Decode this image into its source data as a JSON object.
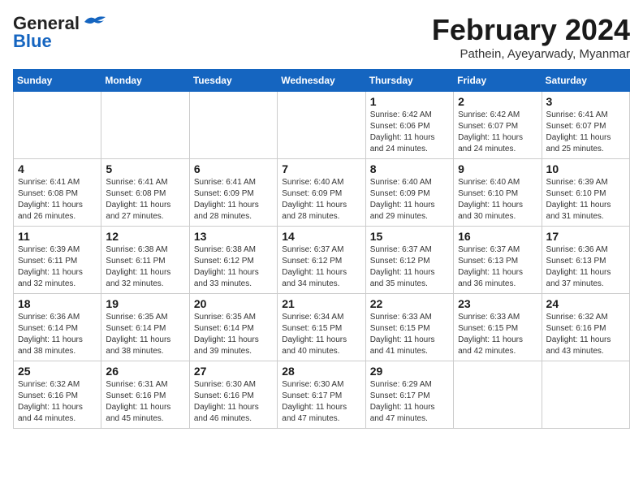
{
  "header": {
    "logo_general": "General",
    "logo_blue": "Blue",
    "month_title": "February 2024",
    "subtitle": "Pathein, Ayeyarwady, Myanmar"
  },
  "calendar": {
    "days_of_week": [
      "Sunday",
      "Monday",
      "Tuesday",
      "Wednesday",
      "Thursday",
      "Friday",
      "Saturday"
    ],
    "weeks": [
      [
        {
          "day": "",
          "sunrise": "",
          "sunset": "",
          "daylight": "",
          "empty": true
        },
        {
          "day": "",
          "sunrise": "",
          "sunset": "",
          "daylight": "",
          "empty": true
        },
        {
          "day": "",
          "sunrise": "",
          "sunset": "",
          "daylight": "",
          "empty": true
        },
        {
          "day": "",
          "sunrise": "",
          "sunset": "",
          "daylight": "",
          "empty": true
        },
        {
          "day": "1",
          "sunrise": "Sunrise: 6:42 AM",
          "sunset": "Sunset: 6:06 PM",
          "daylight": "Daylight: 11 hours and 24 minutes.",
          "empty": false
        },
        {
          "day": "2",
          "sunrise": "Sunrise: 6:42 AM",
          "sunset": "Sunset: 6:07 PM",
          "daylight": "Daylight: 11 hours and 24 minutes.",
          "empty": false
        },
        {
          "day": "3",
          "sunrise": "Sunrise: 6:41 AM",
          "sunset": "Sunset: 6:07 PM",
          "daylight": "Daylight: 11 hours and 25 minutes.",
          "empty": false
        }
      ],
      [
        {
          "day": "4",
          "sunrise": "Sunrise: 6:41 AM",
          "sunset": "Sunset: 6:08 PM",
          "daylight": "Daylight: 11 hours and 26 minutes.",
          "empty": false
        },
        {
          "day": "5",
          "sunrise": "Sunrise: 6:41 AM",
          "sunset": "Sunset: 6:08 PM",
          "daylight": "Daylight: 11 hours and 27 minutes.",
          "empty": false
        },
        {
          "day": "6",
          "sunrise": "Sunrise: 6:41 AM",
          "sunset": "Sunset: 6:09 PM",
          "daylight": "Daylight: 11 hours and 28 minutes.",
          "empty": false
        },
        {
          "day": "7",
          "sunrise": "Sunrise: 6:40 AM",
          "sunset": "Sunset: 6:09 PM",
          "daylight": "Daylight: 11 hours and 28 minutes.",
          "empty": false
        },
        {
          "day": "8",
          "sunrise": "Sunrise: 6:40 AM",
          "sunset": "Sunset: 6:09 PM",
          "daylight": "Daylight: 11 hours and 29 minutes.",
          "empty": false
        },
        {
          "day": "9",
          "sunrise": "Sunrise: 6:40 AM",
          "sunset": "Sunset: 6:10 PM",
          "daylight": "Daylight: 11 hours and 30 minutes.",
          "empty": false
        },
        {
          "day": "10",
          "sunrise": "Sunrise: 6:39 AM",
          "sunset": "Sunset: 6:10 PM",
          "daylight": "Daylight: 11 hours and 31 minutes.",
          "empty": false
        }
      ],
      [
        {
          "day": "11",
          "sunrise": "Sunrise: 6:39 AM",
          "sunset": "Sunset: 6:11 PM",
          "daylight": "Daylight: 11 hours and 32 minutes.",
          "empty": false
        },
        {
          "day": "12",
          "sunrise": "Sunrise: 6:38 AM",
          "sunset": "Sunset: 6:11 PM",
          "daylight": "Daylight: 11 hours and 32 minutes.",
          "empty": false
        },
        {
          "day": "13",
          "sunrise": "Sunrise: 6:38 AM",
          "sunset": "Sunset: 6:12 PM",
          "daylight": "Daylight: 11 hours and 33 minutes.",
          "empty": false
        },
        {
          "day": "14",
          "sunrise": "Sunrise: 6:37 AM",
          "sunset": "Sunset: 6:12 PM",
          "daylight": "Daylight: 11 hours and 34 minutes.",
          "empty": false
        },
        {
          "day": "15",
          "sunrise": "Sunrise: 6:37 AM",
          "sunset": "Sunset: 6:12 PM",
          "daylight": "Daylight: 11 hours and 35 minutes.",
          "empty": false
        },
        {
          "day": "16",
          "sunrise": "Sunrise: 6:37 AM",
          "sunset": "Sunset: 6:13 PM",
          "daylight": "Daylight: 11 hours and 36 minutes.",
          "empty": false
        },
        {
          "day": "17",
          "sunrise": "Sunrise: 6:36 AM",
          "sunset": "Sunset: 6:13 PM",
          "daylight": "Daylight: 11 hours and 37 minutes.",
          "empty": false
        }
      ],
      [
        {
          "day": "18",
          "sunrise": "Sunrise: 6:36 AM",
          "sunset": "Sunset: 6:14 PM",
          "daylight": "Daylight: 11 hours and 38 minutes.",
          "empty": false
        },
        {
          "day": "19",
          "sunrise": "Sunrise: 6:35 AM",
          "sunset": "Sunset: 6:14 PM",
          "daylight": "Daylight: 11 hours and 38 minutes.",
          "empty": false
        },
        {
          "day": "20",
          "sunrise": "Sunrise: 6:35 AM",
          "sunset": "Sunset: 6:14 PM",
          "daylight": "Daylight: 11 hours and 39 minutes.",
          "empty": false
        },
        {
          "day": "21",
          "sunrise": "Sunrise: 6:34 AM",
          "sunset": "Sunset: 6:15 PM",
          "daylight": "Daylight: 11 hours and 40 minutes.",
          "empty": false
        },
        {
          "day": "22",
          "sunrise": "Sunrise: 6:33 AM",
          "sunset": "Sunset: 6:15 PM",
          "daylight": "Daylight: 11 hours and 41 minutes.",
          "empty": false
        },
        {
          "day": "23",
          "sunrise": "Sunrise: 6:33 AM",
          "sunset": "Sunset: 6:15 PM",
          "daylight": "Daylight: 11 hours and 42 minutes.",
          "empty": false
        },
        {
          "day": "24",
          "sunrise": "Sunrise: 6:32 AM",
          "sunset": "Sunset: 6:16 PM",
          "daylight": "Daylight: 11 hours and 43 minutes.",
          "empty": false
        }
      ],
      [
        {
          "day": "25",
          "sunrise": "Sunrise: 6:32 AM",
          "sunset": "Sunset: 6:16 PM",
          "daylight": "Daylight: 11 hours and 44 minutes.",
          "empty": false
        },
        {
          "day": "26",
          "sunrise": "Sunrise: 6:31 AM",
          "sunset": "Sunset: 6:16 PM",
          "daylight": "Daylight: 11 hours and 45 minutes.",
          "empty": false
        },
        {
          "day": "27",
          "sunrise": "Sunrise: 6:30 AM",
          "sunset": "Sunset: 6:16 PM",
          "daylight": "Daylight: 11 hours and 46 minutes.",
          "empty": false
        },
        {
          "day": "28",
          "sunrise": "Sunrise: 6:30 AM",
          "sunset": "Sunset: 6:17 PM",
          "daylight": "Daylight: 11 hours and 47 minutes.",
          "empty": false
        },
        {
          "day": "29",
          "sunrise": "Sunrise: 6:29 AM",
          "sunset": "Sunset: 6:17 PM",
          "daylight": "Daylight: 11 hours and 47 minutes.",
          "empty": false
        },
        {
          "day": "",
          "sunrise": "",
          "sunset": "",
          "daylight": "",
          "empty": true
        },
        {
          "day": "",
          "sunrise": "",
          "sunset": "",
          "daylight": "",
          "empty": true
        }
      ]
    ]
  }
}
